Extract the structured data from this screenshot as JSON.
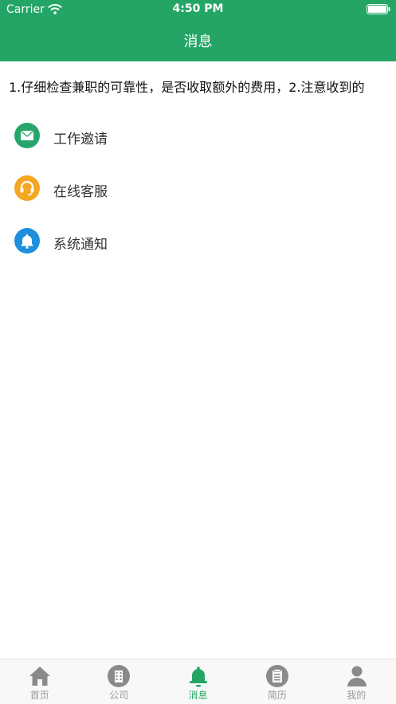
{
  "status_bar": {
    "carrier": "Carrier",
    "time": "4:50 PM"
  },
  "nav": {
    "title": "消息"
  },
  "notice": {
    "text": "1.仔细检查兼职的可靠性，是否收取额外的费用，2.注意收到的"
  },
  "messages": [
    {
      "label": "工作邀请",
      "icon": "mail-icon",
      "color": "#27a56a"
    },
    {
      "label": "在线客服",
      "icon": "headset-icon",
      "color": "#f5a623"
    },
    {
      "label": "系统通知",
      "icon": "bell-icon",
      "color": "#1e8fdc"
    }
  ],
  "tabs": [
    {
      "label": "首页",
      "icon": "home-icon",
      "active": false
    },
    {
      "label": "公司",
      "icon": "building-icon",
      "active": false
    },
    {
      "label": "消息",
      "icon": "bell-icon",
      "active": true
    },
    {
      "label": "简历",
      "icon": "document-icon",
      "active": false
    },
    {
      "label": "我的",
      "icon": "person-icon",
      "active": false
    }
  ],
  "colors": {
    "primary": "#25a565",
    "tab_inactive": "#999999"
  }
}
